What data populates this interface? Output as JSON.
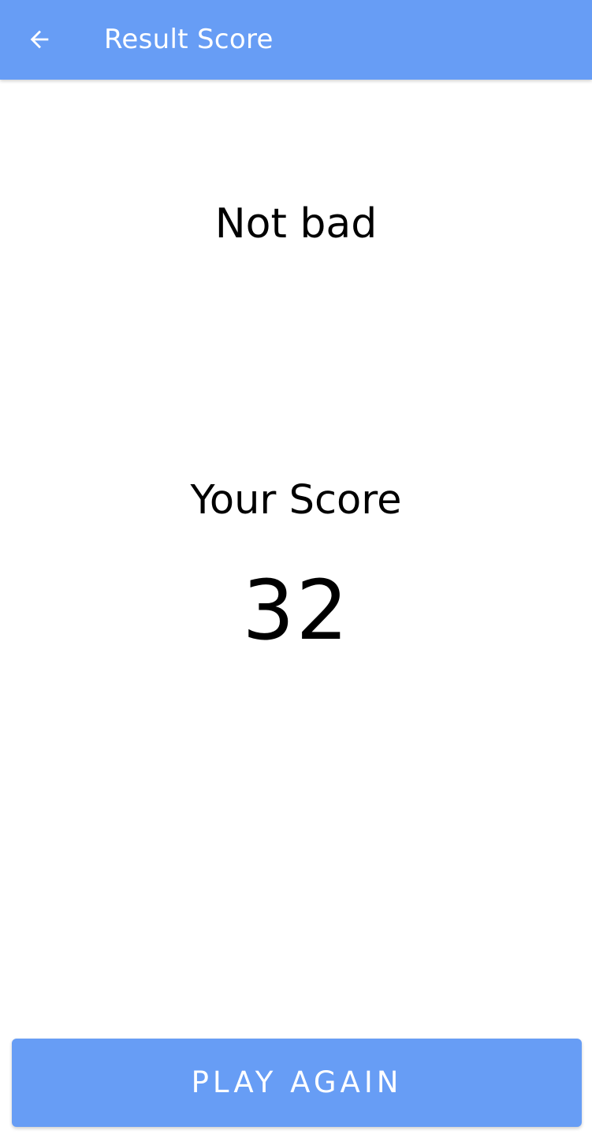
{
  "app_bar": {
    "title": "Result Score",
    "back_icon": "arrow-back-icon",
    "background_color": "#679df5"
  },
  "result": {
    "rating_text": "Not bad",
    "score_label": "Your Score",
    "score_value": "32"
  },
  "actions": {
    "play_again_label": "PLAY AGAIN",
    "button_color": "#679df5"
  }
}
